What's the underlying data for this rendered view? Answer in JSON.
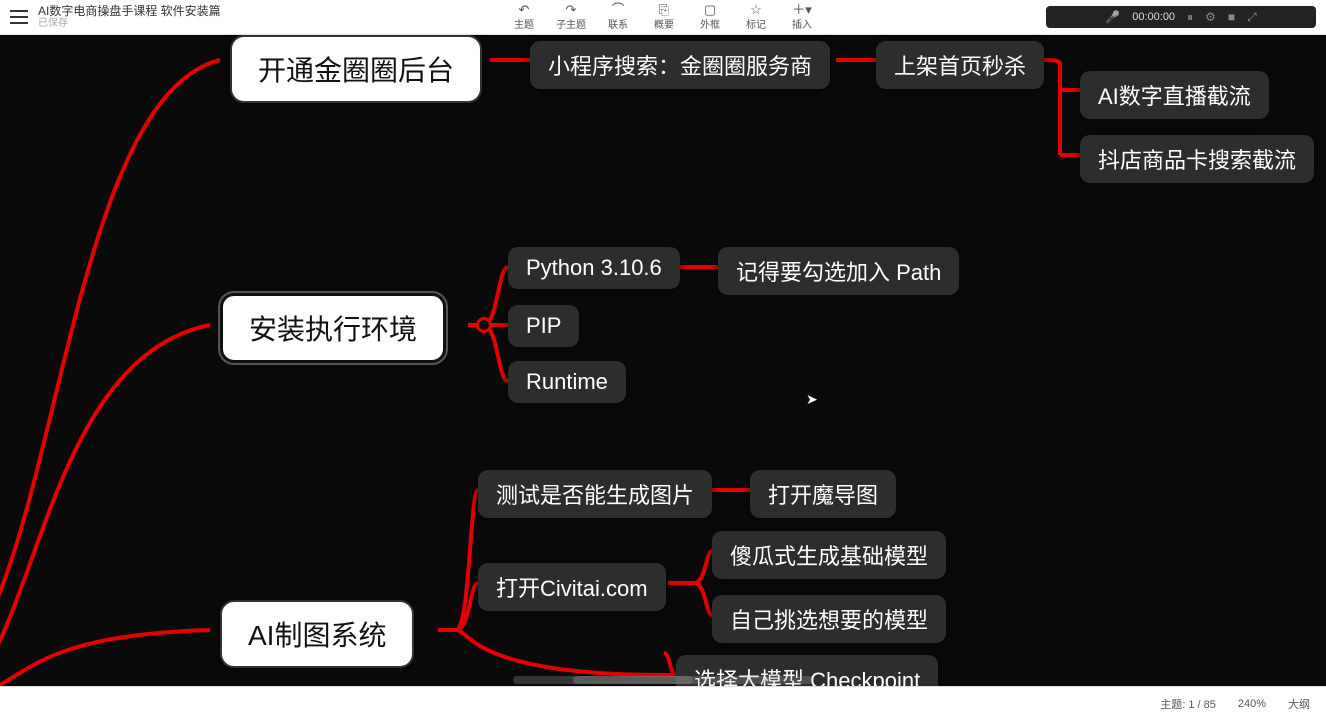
{
  "doc": {
    "title": "AI数字电商操盘手课程 软件安装篇",
    "status": "已保存"
  },
  "toolbar": {
    "items": [
      {
        "label": "主题",
        "icon": "↶"
      },
      {
        "label": "子主题",
        "icon": "↷"
      },
      {
        "label": "联系",
        "icon": "⌒"
      },
      {
        "label": "概要",
        "icon": "⎘"
      },
      {
        "label": "外框",
        "icon": "▢"
      },
      {
        "label": "标记",
        "icon": "☆"
      },
      {
        "label": "插入",
        "icon": "＋▾"
      }
    ]
  },
  "recorder": {
    "time": "00:00:00",
    "mic": "🎤",
    "pause": "⏸",
    "settings": "⚙",
    "stop": "■",
    "expand": "⤢"
  },
  "nodes": {
    "n_jinquan": "开通金圈圈后台",
    "n_search": "小程序搜索：金圈圈服务商",
    "n_shangjia": "上架首页秒杀",
    "n_ai_live": "AI数字直播截流",
    "n_doudian": "抖店商品卡搜索截流",
    "n_env": "安装执行环境",
    "n_python": "Python 3.10.6",
    "n_pip": "PIP",
    "n_runtime": "Runtime",
    "n_path": "记得要勾选加入 Path",
    "n_aiimg": "AI制图系统",
    "n_test": "测试是否能生成图片",
    "n_modao": "打开魔导图",
    "n_civitai": "打开Civitai.com",
    "n_shagua": "傻瓜式生成基础模型",
    "n_pick": "自己挑选想要的模型",
    "n_checkpoint": "选择大模型 Checkpoint"
  },
  "status": {
    "topics": "主题: 1 / 85",
    "zoom": "240%",
    "view": "大纲"
  }
}
